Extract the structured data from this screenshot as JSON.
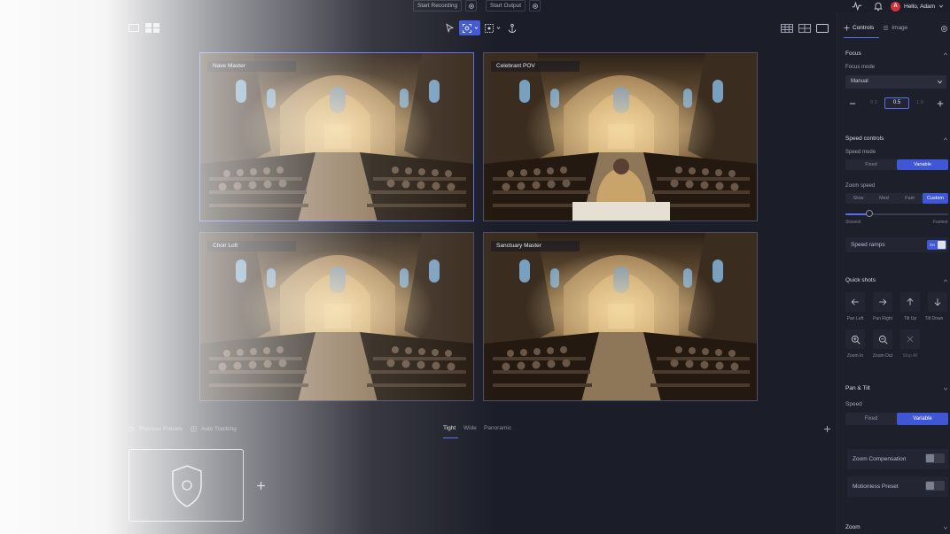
{
  "topbar": {
    "start_recording": "Start Recording",
    "start_output": "Start Output",
    "greeting": "Hello, Adam",
    "avatar_initial": "A",
    "accent": "#3f57d4"
  },
  "cameras": [
    {
      "label": "Nave Master",
      "selected": true
    },
    {
      "label": "Celebrant POV",
      "selected": false
    },
    {
      "label": "Choir Loft",
      "selected": false
    },
    {
      "label": "Sanctuary Master",
      "selected": false
    }
  ],
  "bottom": {
    "presets_tabs": [
      "Previous Presets",
      "Auto Tracking"
    ],
    "view_tabs": [
      "Tight",
      "Wide",
      "Panoramic"
    ],
    "active_view": "Tight"
  },
  "panel": {
    "tabs": [
      "Controls",
      "Image"
    ],
    "active_tab": "Controls",
    "focus": {
      "title": "Focus",
      "mode_label": "Focus mode",
      "mode_value": "Manual",
      "step_low": "0.0",
      "step_value": "0.5",
      "step_high": "1.0"
    },
    "speed": {
      "title": "Speed controls",
      "mode_label": "Speed mode",
      "mode_options": [
        "Fixed",
        "Variable"
      ],
      "mode_selected": "Variable",
      "zoom_label": "Zoom speed",
      "zoom_options": [
        "Slow",
        "Med",
        "Fast",
        "Custom"
      ],
      "zoom_selected": "Custom",
      "slider_value": 0.23,
      "slider_min_label": "Slowest",
      "slider_max_label": "Fastest",
      "ramps_label": "Speed ramps",
      "ramps_state": "On",
      "ramps_on": true
    },
    "quick_shots": {
      "title": "Quick shots",
      "items": [
        {
          "label": "Pan Left",
          "icon": "arrow-left-icon"
        },
        {
          "label": "Pan Right",
          "icon": "arrow-right-icon"
        },
        {
          "label": "Tilt Up",
          "icon": "arrow-up-icon"
        },
        {
          "label": "Tilt Down",
          "icon": "arrow-down-icon"
        },
        {
          "label": "Zoom In",
          "icon": "zoom-in-icon"
        },
        {
          "label": "Zoom Out",
          "icon": "zoom-out-icon"
        },
        {
          "label": "Stop All",
          "icon": "close-icon"
        }
      ]
    },
    "pan_tilt": {
      "title": "Pan & Tilt",
      "speed_label": "Speed",
      "options": [
        "Fixed",
        "Variable"
      ],
      "selected": "Variable",
      "zoom_comp_label": "Zoom Compensation",
      "motionless_label": "Motionless Preset"
    },
    "zoom": {
      "title": "Zoom"
    }
  }
}
